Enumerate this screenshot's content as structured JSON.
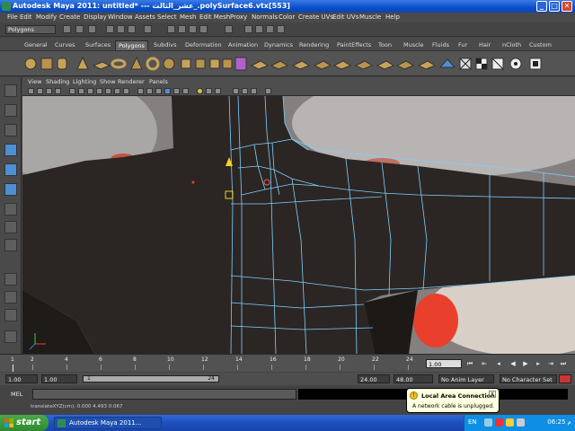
{
  "window": {
    "title": "Autodesk Maya 2011: untitled*   ---   عشر_الثالث_.polySurface6.vtx[553]",
    "minimize": "_",
    "maximize": "□",
    "close": "✕"
  },
  "menubar": [
    "File",
    "Edit",
    "Modify",
    "Create",
    "Display",
    "Window",
    "Assets",
    "Select",
    "Mesh",
    "Edit Mesh",
    "Proxy",
    "Normals",
    "Color",
    "Create UVs",
    "Edit UVs",
    "Muscle",
    "Help"
  ],
  "statusline": {
    "mode": "Polygons"
  },
  "shelf_tabs": [
    "General",
    "Curves",
    "Surfaces",
    "Polygons",
    "Subdivs",
    "Deformation",
    "Animation",
    "Dynamics",
    "Rendering",
    "PaintEffects",
    "Toon",
    "Muscle",
    "Fluids",
    "Fur",
    "Hair",
    "nCloth",
    "Custom"
  ],
  "shelf_active_tab": "Polygons",
  "panel_menu": [
    "View",
    "Shading",
    "Lighting",
    "Show",
    "Renderer",
    "Panels"
  ],
  "timeline": {
    "ticks": [
      "1",
      "2",
      "4",
      "6",
      "8",
      "10",
      "12",
      "14",
      "16",
      "18",
      "20",
      "22",
      "24"
    ],
    "current_frame": "1.00",
    "start_label": "1"
  },
  "range": {
    "start_time": "1.00",
    "playback_start": "1.00",
    "bar_start": "1",
    "bar_end": "24",
    "playback_end": "24.00",
    "end_time": "48.00",
    "anim_layer": "No Anim Layer",
    "character_set": "No Character Set"
  },
  "command": {
    "label": "MEL"
  },
  "help_line": "translateXYZ(cm):  0.000   4.493   0.067",
  "balloon": {
    "title": "Local Area Connection",
    "body": "A network cable is unplugged.",
    "icon": "!",
    "close": "x"
  },
  "taskbar": {
    "start": "start",
    "task": "Autodesk Maya 2011...",
    "lang": "EN",
    "clock": "06:25 م"
  },
  "colors": {
    "mesh_dark": "#2b2623",
    "wire": "#7fd0ff",
    "highlight_red": "#e8402c",
    "xp_blue": "#0a4fc8"
  }
}
